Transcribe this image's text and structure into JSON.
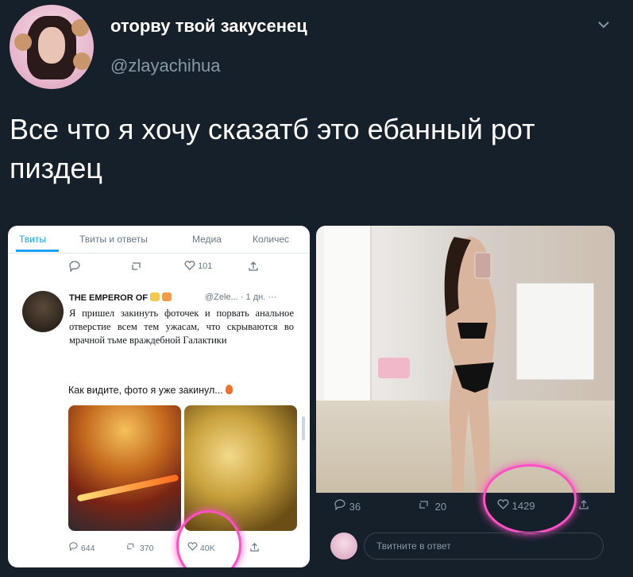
{
  "author": {
    "display_name": "оторву твой закусенец",
    "handle": "@zlayachihua"
  },
  "tweet": {
    "text": "Все что я хочу сказатб это ебанный рот пиздец"
  },
  "left_screenshot": {
    "tabs": [
      "Твиты",
      "Твиты и ответы",
      "Медиа",
      "Количес"
    ],
    "top_actions": {
      "like_count": "101"
    },
    "embedded_tweet": {
      "name": "THE EMPEROR OF",
      "handle": "@Zele...",
      "time": "· 1 дн.",
      "more": "···",
      "body": "Я пришел закинуть фоточек и порвать анальное отверстие всем тем ужасам, что скрываются во мрачной тьме враждебной Галактики",
      "caption": "Как видите, фото я уже закинул...",
      "reply_count": "644",
      "retweet_count": "370",
      "like_count": "40K"
    }
  },
  "right_screenshot": {
    "reply_count": "36",
    "retweet_count": "20",
    "like_count": "1429",
    "reply_placeholder": "Твитните в ответ"
  },
  "colors": {
    "background": "#15202b",
    "accent": "#1da1f2",
    "highlight_circle": "#ff4fc4"
  }
}
